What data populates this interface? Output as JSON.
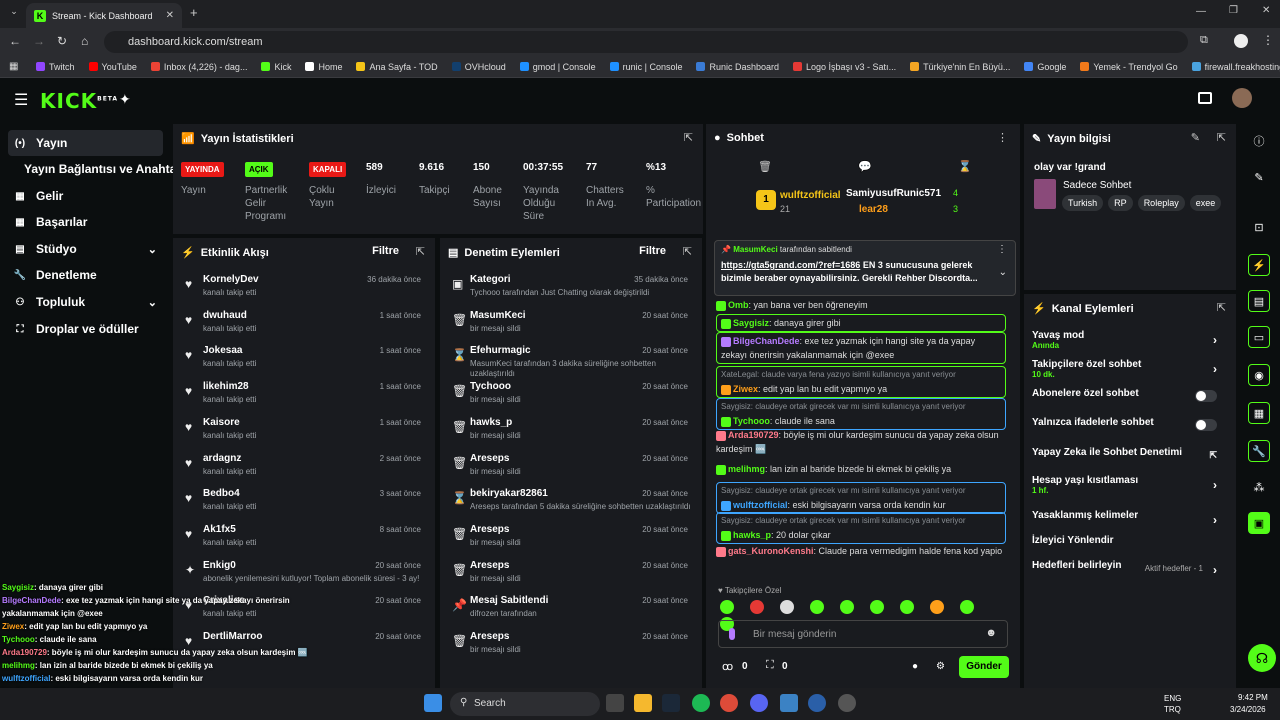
{
  "browser": {
    "tab_title": "Stream - Kick Dashboard",
    "url": "dashboard.kick.com/stream",
    "bookmarks": [
      {
        "label": "Twitch",
        "color": "#9146ff"
      },
      {
        "label": "YouTube",
        "color": "#ff0000"
      },
      {
        "label": "Inbox (4,226) - dag...",
        "color": "#ea4335"
      },
      {
        "label": "Kick",
        "color": "#53fc18"
      },
      {
        "label": "Home",
        "color": "#ffffff"
      },
      {
        "label": "Ana Sayfa - TOD",
        "color": "#f5c518"
      },
      {
        "label": "OVHcloud",
        "color": "#123f6d"
      },
      {
        "label": "gmod | Console",
        "color": "#1e90ff"
      },
      {
        "label": "runic | Console",
        "color": "#1e90ff"
      },
      {
        "label": "Runic Dashboard",
        "color": "#3a7bd5"
      },
      {
        "label": "Logo İşbaşı v3 - Satı...",
        "color": "#e53935"
      },
      {
        "label": "Türkiye'nin En Büyü...",
        "color": "#f5a623"
      },
      {
        "label": "Google",
        "color": "#4285f4"
      },
      {
        "label": "Yemek - Trendyol Go",
        "color": "#f27a1a"
      },
      {
        "label": "firewall.freakhosting...",
        "color": "#4aa3df"
      }
    ]
  },
  "sidebar": {
    "items": [
      {
        "label": "Yayın",
        "icon": "broadcast-icon",
        "active": true
      },
      {
        "label": "Yayın Bağlantısı ve Anahtarı",
        "icon": ""
      },
      {
        "label": "Gelir",
        "icon": "revenue-icon"
      },
      {
        "label": "Başarılar",
        "icon": "achievements-icon"
      },
      {
        "label": "Stüdyo",
        "icon": "studio-icon",
        "chevron": true
      },
      {
        "label": "Denetleme",
        "icon": "moderation-icon"
      },
      {
        "label": "Topluluk",
        "icon": "community-icon",
        "chevron": true
      },
      {
        "label": "Droplar ve ödüller",
        "icon": "drops-icon"
      }
    ]
  },
  "stats": {
    "title": "Yayın İstatistikleri",
    "items": [
      {
        "badge": "YAYINDA",
        "label": "Yayın",
        "badge_color": "#e91916"
      },
      {
        "badge": "AÇIK",
        "label": "Partnerlik Gelir Programı",
        "badge_color": "#53fc18"
      },
      {
        "badge": "KAPALI",
        "label": "Çoklu Yayın",
        "badge_color": "#e91916"
      },
      {
        "value": "589",
        "label": "İzleyici"
      },
      {
        "value": "9.616",
        "label": "Takipçi"
      },
      {
        "value": "150",
        "label": "Abone Sayısı"
      },
      {
        "value": "00:37:55",
        "label": "Yayında Olduğu Süre"
      },
      {
        "value": "77",
        "label": "Chatters In Avg."
      },
      {
        "value": "%13",
        "label": "% Participation"
      }
    ]
  },
  "activity": {
    "title": "Etkinlik Akışı",
    "filter": "Filtre",
    "events": [
      {
        "name": "KornelyDev",
        "sub": "kanalı takip etti",
        "time": "36 dakika önce"
      },
      {
        "name": "dwuhaud",
        "sub": "kanalı takip etti",
        "time": "1 saat önce"
      },
      {
        "name": "Jokesaa",
        "sub": "kanalı takip etti",
        "time": "1 saat önce"
      },
      {
        "name": "likehim28",
        "sub": "kanalı takip etti",
        "time": "1 saat önce"
      },
      {
        "name": "Kaisore",
        "sub": "kanalı takip etti",
        "time": "1 saat önce"
      },
      {
        "name": "ardagnz",
        "sub": "kanalı takip etti",
        "time": "2 saat önce"
      },
      {
        "name": "Bedbo4",
        "sub": "kanalı takip etti",
        "time": "3 saat önce"
      },
      {
        "name": "Ak1fx5",
        "sub": "kanalı takip etti",
        "time": "8 saat önce"
      },
      {
        "name": "Enkig0",
        "sub": "abonelik yenilemesini kutluyor! Toplam abonelik süresi - 3 ay!",
        "time": "20 saat önce"
      },
      {
        "name": "Crixaliss",
        "sub": "kanalı takip etti",
        "time": "20 saat önce"
      },
      {
        "name": "DertliMarroo",
        "sub": "",
        "time": "20 saat önce"
      }
    ]
  },
  "modactions": {
    "title": "Denetim Eylemleri",
    "filter": "Filtre",
    "events": [
      {
        "name": "Kategori",
        "sub": "Tychooo tarafından Just Chatting olarak değiştirildi",
        "time": "35 dakika önce"
      },
      {
        "name": "MasumKeci",
        "sub": "bir mesajı sildi",
        "time": "20 saat önce"
      },
      {
        "name": "Efehurmagic",
        "sub": "MasumKeci tarafından 3 dakika süreliğine sohbetten uzaklaştırıldı",
        "time": "20 saat önce"
      },
      {
        "name": "Tychooo",
        "sub": "bir mesajı sildi",
        "time": "20 saat önce"
      },
      {
        "name": "hawks_p",
        "sub": "bir mesajı sildi",
        "time": "20 saat önce"
      },
      {
        "name": "Areseps",
        "sub": "bir mesajı sildi",
        "time": "20 saat önce"
      },
      {
        "name": "bekiryakar82861",
        "sub": "Areseps tarafından 5 dakika süreliğine sohbetten uzaklaştırıldı",
        "time": "20 saat önce"
      },
      {
        "name": "Areseps",
        "sub": "bir mesajı sildi",
        "time": "20 saat önce"
      },
      {
        "name": "Areseps",
        "sub": "bir mesajı sildi",
        "time": "20 saat önce"
      },
      {
        "name": "Mesaj Sabitlendi",
        "sub": "difrozen tarafından",
        "time": "20 saat önce"
      },
      {
        "name": "Areseps",
        "sub": "bir mesajı sildi",
        "time": "20 saat önce"
      }
    ]
  },
  "chat": {
    "title": "Sohbet",
    "top_gifter": "wulftzofficial",
    "top_gifter_count": "21",
    "gifters": [
      {
        "name": "SamiyusufRunic571",
        "count": "4"
      },
      {
        "name": "lear28",
        "count": "3"
      }
    ],
    "pinned": {
      "user": "MasumKeci",
      "label": "tarafından sabitlendi",
      "link": "https://gta5grand.com/?ref=1686",
      "text": "EN 3 sunucusuna gelerek bizimle beraber oynayabilirsiniz. Gerekli Rehber Discordta..."
    },
    "messages": [
      {
        "reply": "",
        "user": "Omb",
        "text": "yan bana ver ben öğreneyim",
        "color": "#53fc18"
      },
      {
        "reply": "",
        "user": "Saygisiz",
        "text": "danaya girer gibi",
        "color": "#53fc18"
      },
      {
        "reply": "",
        "user": "BilgeChanDede",
        "text": "exe tez yazmak için hangi site ya da yapay zekayı önerirsin yakalanmamak için @exee",
        "color": "#b57bff"
      },
      {
        "reply": "XateLegal: claude varya fena yazıyo isimli kullanıcıya yanıt veriyor",
        "user": "Ziwex",
        "text": "edit yap lan bu edit yapmıyo ya",
        "color": "#ff9f1a"
      },
      {
        "reply": "Saygisiz: claudeye ortak girecek var mı isimli kullanıcıya yanıt veriyor",
        "user": "Tychooo",
        "text": "claude ile sana",
        "color": "#53fc18"
      },
      {
        "reply": "",
        "user": "Arda190729",
        "text": "böyle iş mi olur kardeşim sunucu da yapay zeka olsun kardeşim 🆒",
        "color": "#ff7a8a"
      },
      {
        "reply": "",
        "user": "melihmg",
        "text": "lan izin al baride bizede bi ekmek bi çekiliş ya",
        "color": "#53fc18"
      },
      {
        "reply": "Saygisiz: claudeye ortak girecek var mı isimli kullanıcıya yanıt veriyor",
        "user": "wulftzofficial",
        "text": "eski bilgisayarın varsa orda kendin kur",
        "color": "#3ea6ff"
      },
      {
        "reply": "Saygisiz: claudeye ortak girecek var mı isimli kullanıcıya yanıt veriyor",
        "user": "hawks_p",
        "text": "20 dolar çıkar",
        "color": "#53fc18"
      },
      {
        "reply": "",
        "user": "gats_KuronoKenshi",
        "text": "Claude para vermedigim halde fena kod yapio",
        "color": "#ff7a8a"
      }
    ],
    "mode_label": "Takipçilere Özel",
    "input_placeholder": "Bir mesaj gönderin",
    "send": "Gönder",
    "points": "0"
  },
  "streaminfo": {
    "title": "Yayın bilgisi",
    "stream_title": "olay var !grand",
    "category": "Sadece Sohbet",
    "tags": [
      "Turkish",
      "RP",
      "Roleplay",
      "exee"
    ]
  },
  "channel": {
    "title": "Kanal Eylemleri",
    "rows": [
      {
        "label": "Yavaş mod",
        "sub": "Anında",
        "type": "chev"
      },
      {
        "label": "Takipçilere özel sohbet",
        "sub": "10 dk.",
        "type": "chev"
      },
      {
        "label": "Abonelere özel sohbet",
        "type": "toggle"
      },
      {
        "label": "Yalnızca ifadelerle sohbet",
        "type": "toggle"
      },
      {
        "label": "Yapay Zeka ile Sohbet Denetimi",
        "type": "link"
      },
      {
        "label": "Hesap yaşı kısıtlaması",
        "sub": "1 hf.",
        "type": "chev"
      },
      {
        "label": "Yasaklanmış kelimeler",
        "type": "chev"
      },
      {
        "label": "İzleyici Yönlendir",
        "type": "none"
      },
      {
        "label": "Hedefleri belirleyin",
        "extra": "Aktif hedefler - 1",
        "type": "chev"
      }
    ]
  },
  "overlay": [
    {
      "user": "Saygisiz",
      "text": ": danaya girer gibi",
      "color": "#53fc18"
    },
    {
      "user": "BilgeChanDede",
      "text": ": exe tez yazmak için hangi site ya da yapay zekayı önerirsin",
      "color": "#b57bff"
    },
    {
      "user": "",
      "text": "yakalanmamak için @exee",
      "color": "#fff"
    },
    {
      "user": "Ziwex",
      "text": ": edit yap lan bu edit yapmıyo ya",
      "color": "#ff9f1a"
    },
    {
      "user": "Tychooo",
      "text": ": claude ile sana",
      "color": "#53fc18"
    },
    {
      "user": "Arda190729",
      "text": ": böyle iş mi olur kardeşim sunucu da yapay zeka olsun kardeşim 🆒",
      "color": "#ff7a8a"
    },
    {
      "user": "melihmg",
      "text": ": lan izin al baride bizede bi ekmek bi çekiliş ya",
      "color": "#53fc18"
    },
    {
      "user": "wulftzofficial",
      "text": ": eski bilgisayarın varsa orda kendin kur",
      "color": "#3ea6ff"
    },
    {
      "user": "hawks_p",
      "text": ": 20 dolar çıkar",
      "color": "#53fc18"
    },
    {
      "user": "gats_KuronoKenshi",
      "text": ": Claude para vermedigim halde fena kod yapio",
      "color": "#ff7a8a"
    }
  ],
  "taskbar": {
    "search": "Search",
    "lang": "ENG",
    "lang2": "TRQ",
    "time": "9:42 PM",
    "date": "3/24/2026"
  }
}
